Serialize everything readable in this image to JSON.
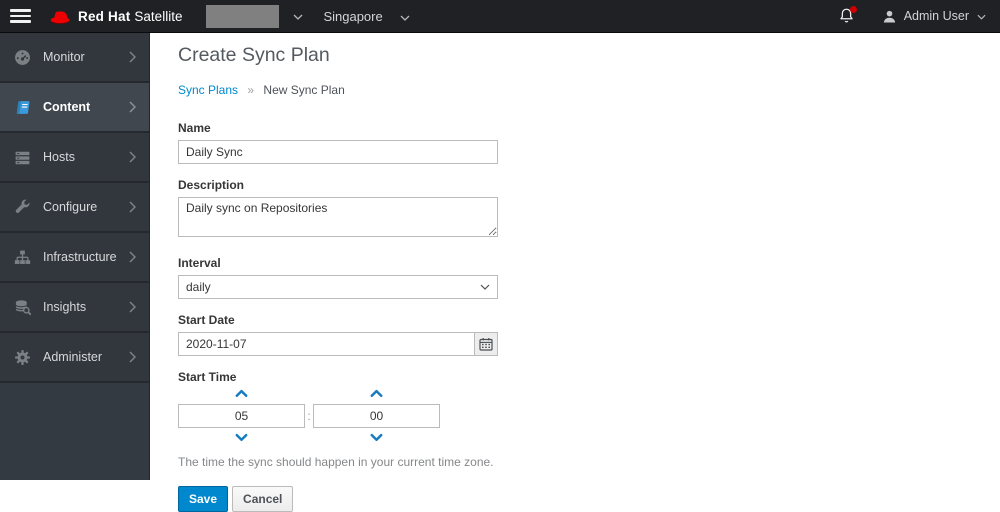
{
  "navbar": {
    "brand_bold": "Red Hat",
    "brand_suffix": "Satellite",
    "organization_redacted": true,
    "location": "Singapore",
    "user": "Admin User"
  },
  "sidebar": {
    "items": [
      {
        "label": "Monitor",
        "icon": "tachometer-icon",
        "active": false
      },
      {
        "label": "Content",
        "icon": "book-icon",
        "active": true
      },
      {
        "label": "Hosts",
        "icon": "server-icon",
        "active": false
      },
      {
        "label": "Configure",
        "icon": "wrench-icon",
        "active": false
      },
      {
        "label": "Infrastructure",
        "icon": "sitemap-icon",
        "active": false
      },
      {
        "label": "Insights",
        "icon": "database-search-icon",
        "active": false
      },
      {
        "label": "Administer",
        "icon": "gear-icon",
        "active": false
      }
    ]
  },
  "page": {
    "title": "Create Sync Plan",
    "breadcrumb": {
      "link": "Sync Plans",
      "separator": "»",
      "current": "New Sync Plan"
    }
  },
  "form": {
    "name": {
      "label": "Name",
      "value": "Daily Sync"
    },
    "description": {
      "label": "Description",
      "value": "Daily sync on Repositories"
    },
    "interval": {
      "label": "Interval",
      "value": "daily"
    },
    "start_date": {
      "label": "Start Date",
      "value": "2020-11-07"
    },
    "start_time": {
      "label": "Start Time",
      "hours": "05",
      "minutes": "00",
      "separator": ":",
      "help": "The time the sync should happen in your current time zone."
    },
    "buttons": {
      "save": "Save",
      "cancel": "Cancel"
    }
  },
  "colors": {
    "primary_button": "#0088ce",
    "link": "#0088ce",
    "active_nav_icon": "#3b9ad9",
    "notification_badge": "#cc0000",
    "masthead_bg": "#1f2125",
    "sidebar_bg": "#343a41",
    "sidebar_active_bg": "#40474f"
  }
}
